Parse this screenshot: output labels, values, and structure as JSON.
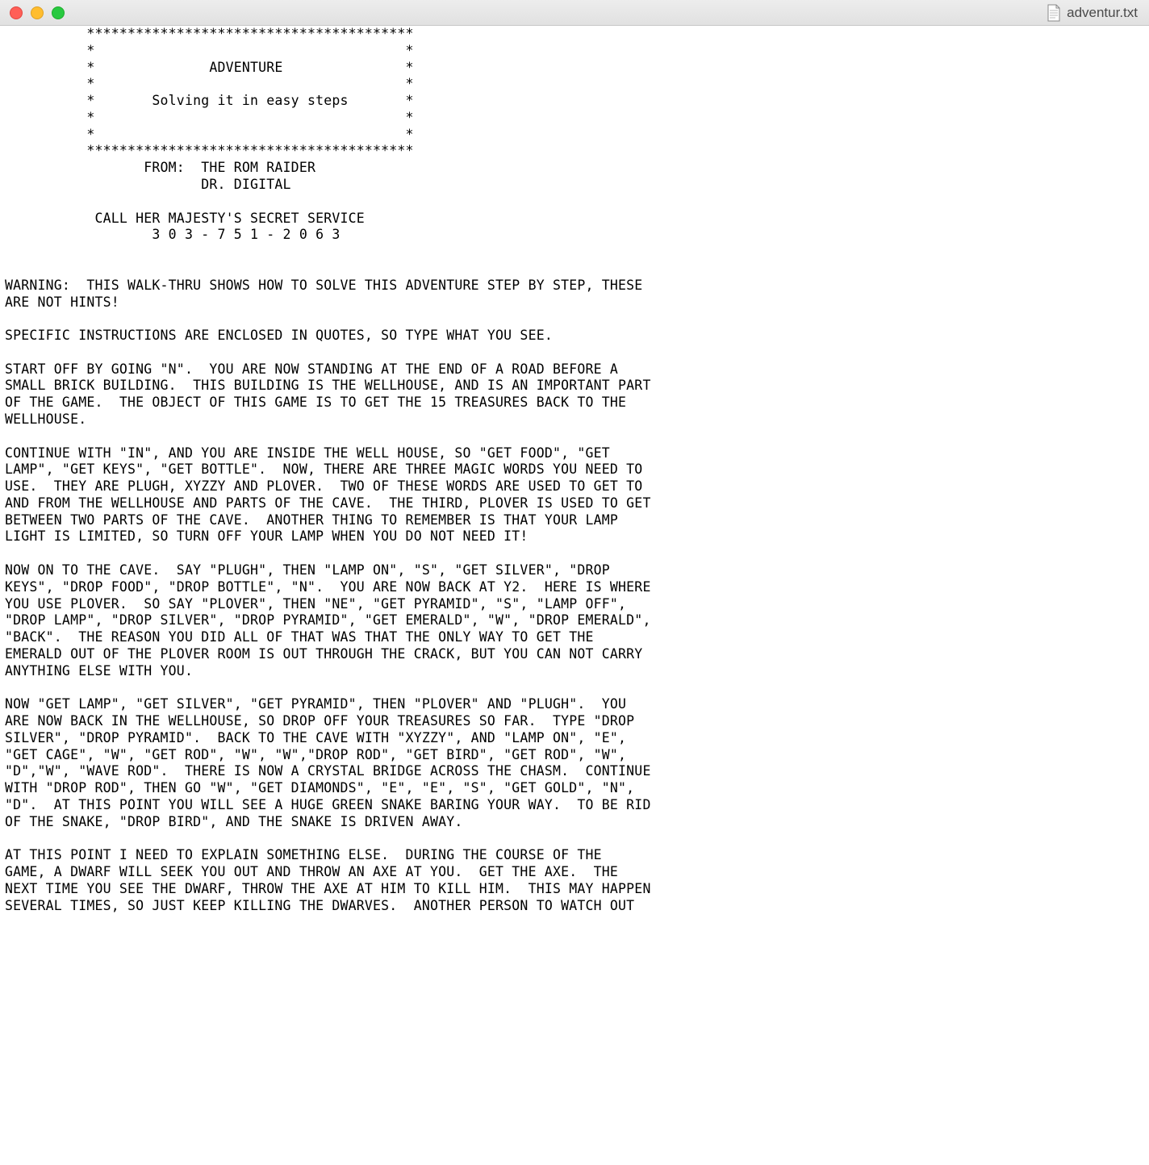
{
  "window": {
    "filename": "adventur.txt"
  },
  "document": {
    "text": "          ****************************************\n          *                                      *\n          *              ADVENTURE               *\n          *                                      *\n          *       Solving it in easy steps       *\n          *                                      *\n          *                                      *\n          ****************************************\n                 FROM:  THE ROM RAIDER\n                        DR. DIGITAL\n\n           CALL HER MAJESTY'S SECRET SERVICE\n                  3 0 3 - 7 5 1 - 2 0 6 3\n\n\nWARNING:  THIS WALK-THRU SHOWS HOW TO SOLVE THIS ADVENTURE STEP BY STEP, THESE\nARE NOT HINTS!\n\nSPECIFIC INSTRUCTIONS ARE ENCLOSED IN QUOTES, SO TYPE WHAT YOU SEE.\n\nSTART OFF BY GOING \"N\".  YOU ARE NOW STANDING AT THE END OF A ROAD BEFORE A\nSMALL BRICK BUILDING.  THIS BUILDING IS THE WELLHOUSE, AND IS AN IMPORTANT PART\nOF THE GAME.  THE OBJECT OF THIS GAME IS TO GET THE 15 TREASURES BACK TO THE\nWELLHOUSE.\n\nCONTINUE WITH \"IN\", AND YOU ARE INSIDE THE WELL HOUSE, SO \"GET FOOD\", \"GET\nLAMP\", \"GET KEYS\", \"GET BOTTLE\".  NOW, THERE ARE THREE MAGIC WORDS YOU NEED TO\nUSE.  THEY ARE PLUGH, XYZZY AND PLOVER.  TWO OF THESE WORDS ARE USED TO GET TO\nAND FROM THE WELLHOUSE AND PARTS OF THE CAVE.  THE THIRD, PLOVER IS USED TO GET\nBETWEEN TWO PARTS OF THE CAVE.  ANOTHER THING TO REMEMBER IS THAT YOUR LAMP\nLIGHT IS LIMITED, SO TURN OFF YOUR LAMP WHEN YOU DO NOT NEED IT!\n\nNOW ON TO THE CAVE.  SAY \"PLUGH\", THEN \"LAMP ON\", \"S\", \"GET SILVER\", \"DROP\nKEYS\", \"DROP FOOD\", \"DROP BOTTLE\", \"N\".  YOU ARE NOW BACK AT Y2.  HERE IS WHERE\nYOU USE PLOVER.  SO SAY \"PLOVER\", THEN \"NE\", \"GET PYRAMID\", \"S\", \"LAMP OFF\",\n\"DROP LAMP\", \"DROP SILVER\", \"DROP PYRAMID\", \"GET EMERALD\", \"W\", \"DROP EMERALD\",\n\"BACK\".  THE REASON YOU DID ALL OF THAT WAS THAT THE ONLY WAY TO GET THE\nEMERALD OUT OF THE PLOVER ROOM IS OUT THROUGH THE CRACK, BUT YOU CAN NOT CARRY\nANYTHING ELSE WITH YOU.\n\nNOW \"GET LAMP\", \"GET SILVER\", \"GET PYRAMID\", THEN \"PLOVER\" AND \"PLUGH\".  YOU\nARE NOW BACK IN THE WELLHOUSE, SO DROP OFF YOUR TREASURES SO FAR.  TYPE \"DROP\nSILVER\", \"DROP PYRAMID\".  BACK TO THE CAVE WITH \"XYZZY\", AND \"LAMP ON\", \"E\",\n\"GET CAGE\", \"W\", \"GET ROD\", \"W\", \"W\",\"DROP ROD\", \"GET BIRD\", \"GET ROD\", \"W\",\n\"D\",\"W\", \"WAVE ROD\".  THERE IS NOW A CRYSTAL BRIDGE ACROSS THE CHASM.  CONTINUE\nWITH \"DROP ROD\", THEN GO \"W\", \"GET DIAMONDS\", \"E\", \"E\", \"S\", \"GET GOLD\", \"N\",\n\"D\".  AT THIS POINT YOU WILL SEE A HUGE GREEN SNAKE BARING YOUR WAY.  TO BE RID\nOF THE SNAKE, \"DROP BIRD\", AND THE SNAKE IS DRIVEN AWAY.\n\nAT THIS POINT I NEED TO EXPLAIN SOMETHING ELSE.  DURING THE COURSE OF THE\nGAME, A DWARF WILL SEEK YOU OUT AND THROW AN AXE AT YOU.  GET THE AXE.  THE\nNEXT TIME YOU SEE THE DWARF, THROW THE AXE AT HIM TO KILL HIM.  THIS MAY HAPPEN\nSEVERAL TIMES, SO JUST KEEP KILLING THE DWARVES.  ANOTHER PERSON TO WATCH OUT"
  }
}
